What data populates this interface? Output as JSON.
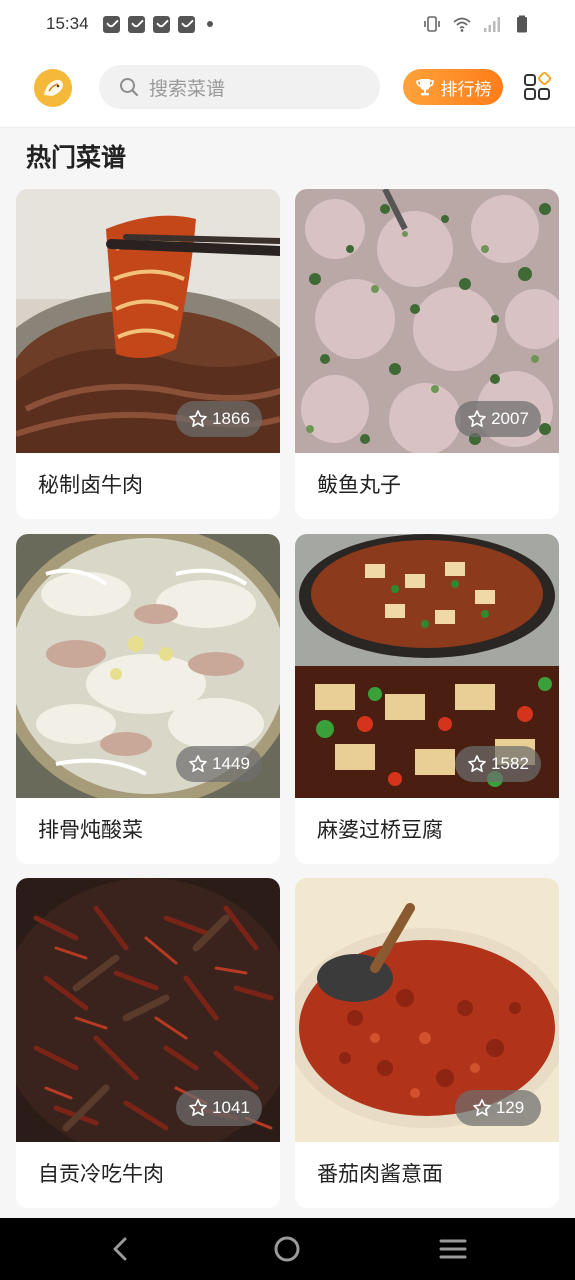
{
  "status_bar": {
    "time": "15:34",
    "notification_icons": [
      "notification-icon",
      "notification-icon",
      "notification-icon",
      "notification-icon"
    ],
    "right_icons": [
      "vibrate-icon",
      "wifi-icon",
      "signal-icon",
      "battery-icon"
    ]
  },
  "header": {
    "avatar_icon": "user-avatar",
    "search_placeholder": "搜索菜谱",
    "search_icon": "search-icon",
    "rank_label": "排行榜",
    "rank_icon": "trophy-icon",
    "grid_icon": "category-grid-icon",
    "accent_color": "#ff8a1f"
  },
  "section": {
    "title": "热门菜谱"
  },
  "recipes": [
    {
      "name": "秘制卤牛肉",
      "stars": "1866",
      "photo": "braised-beef"
    },
    {
      "name": "鲅鱼丸子",
      "stars": "2007",
      "photo": "fish-ball-mix"
    },
    {
      "name": "排骨炖酸菜",
      "stars": "1449",
      "photo": "pork-rib-sauerkraut"
    },
    {
      "name": "麻婆过桥豆腐",
      "stars": "1582",
      "photo": "mapo-tofu"
    },
    {
      "name": "自贡冷吃牛肉",
      "stars": "1041",
      "photo": "spicy-cold-beef"
    },
    {
      "name": "番茄肉酱意面",
      "stars": "129",
      "photo": "bolognese-sauce"
    }
  ],
  "nav_bar": {
    "icons": [
      "back-icon",
      "home-icon",
      "menu-icon"
    ]
  }
}
